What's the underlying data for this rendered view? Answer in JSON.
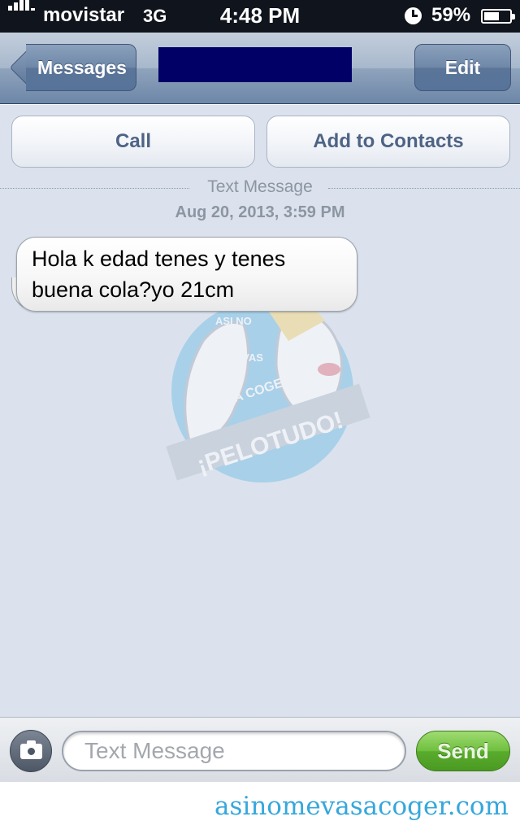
{
  "status_bar": {
    "carrier": "movistar",
    "network": "3G",
    "time": "4:48 PM",
    "battery_percent": "59%",
    "battery_level": 0.59,
    "icons": [
      "signal-bars-icon",
      "clock-icon",
      "battery-icon"
    ]
  },
  "nav": {
    "back_label": "Messages",
    "edit_label": "Edit"
  },
  "actions": {
    "call_label": "Call",
    "add_contacts_label": "Add to Contacts"
  },
  "thread": {
    "type_label": "Text Message",
    "timestamp": "Aug 20, 2013, 3:59 PM",
    "messages": [
      {
        "text": "Hola k edad tenes y tenes buena cola?yo 21cm",
        "direction": "incoming"
      }
    ]
  },
  "watermark": {
    "lines": [
      "ASI NO",
      "ME VAS",
      "A COGER",
      "¡PELOTUDO!"
    ]
  },
  "input": {
    "placeholder": "Text Message",
    "value": "",
    "send_label": "Send"
  },
  "footer": {
    "brand": "asinomevasacoger.com"
  },
  "colors": {
    "chat_background": "#dbe2ed",
    "send_green": "#5aac2d",
    "brand_blue": "#36a7dc",
    "title_redaction": "#000066"
  }
}
